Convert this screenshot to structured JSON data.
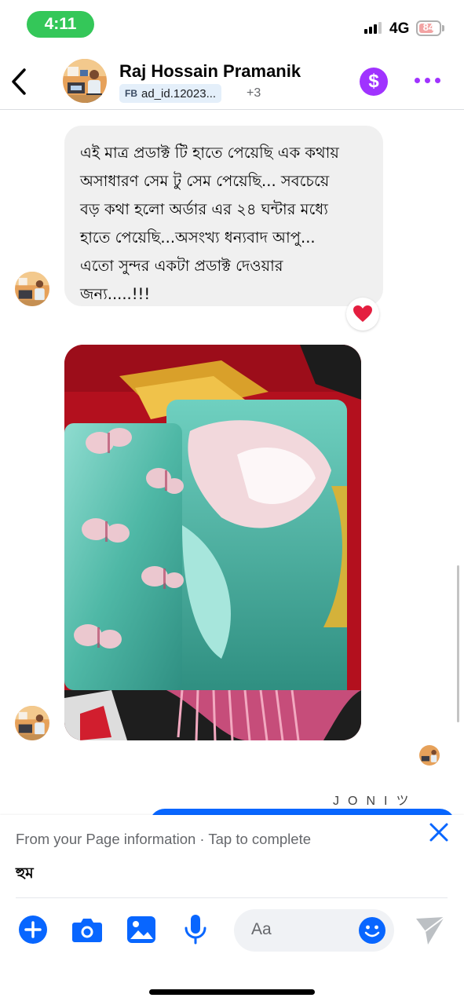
{
  "status_bar": {
    "time": "4:11",
    "network": "4G",
    "battery": "84"
  },
  "header": {
    "contact_name": "Raj Hossain Pramanik",
    "tag_prefix": "FB",
    "tag_label": "ad_id.12023...",
    "more_count": "+3"
  },
  "conversation": {
    "message_text": "এই মাত্র প্রডাক্ট টি হাতে পেয়েছি এক কথায়\nঅসাধারণ সেম টু সেম পেয়েছি... সবচেয়ে\nবড় কথা হলো অর্ডার এর ২৪ ঘন্টার মধ্যে\nহাতে পেয়েছি...অসংখ্য ধন্যবাদ আপু...\nএতো সুন্দর একটা প্রডাক্ট দেওয়ার\nজন্য.....!!!",
    "reaction": "❤️",
    "signature": "JONIツ"
  },
  "composer": {
    "info_text": "From your Page information · Tap to complete",
    "draft_text": "হুম",
    "input_placeholder": "Aa"
  },
  "colors": {
    "accent_blue": "#0866ff",
    "purple": "#a033ff",
    "status_green": "#34c759",
    "bubble_gray": "#f0f0f0"
  }
}
